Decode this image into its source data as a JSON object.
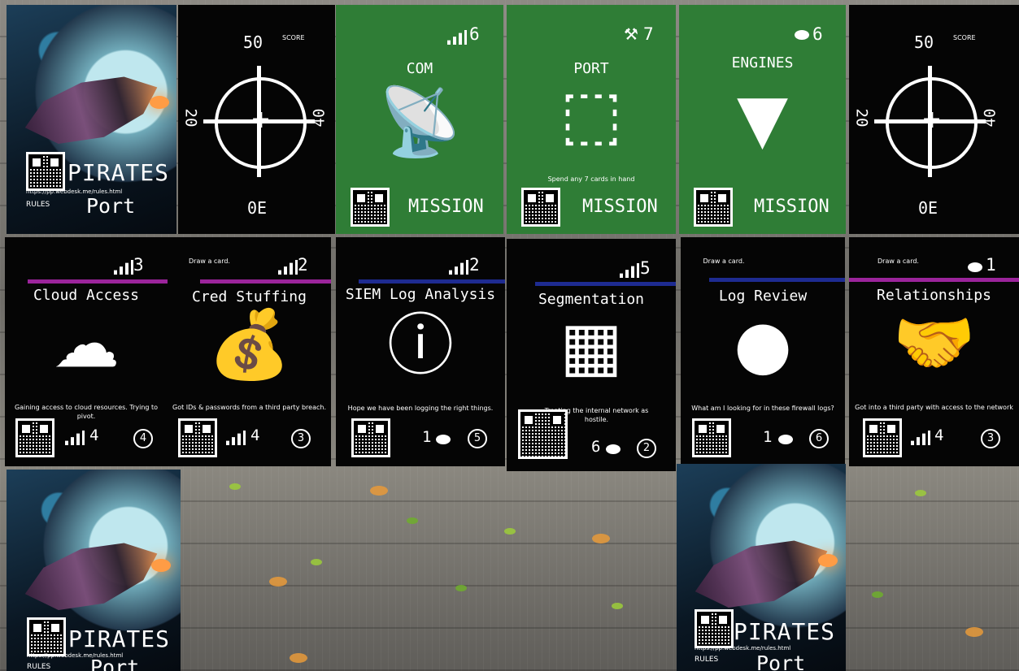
{
  "back_card": {
    "pirates": "PIRATES",
    "url": "https://pp.webdesk.me/rules.html",
    "rules": "RULES",
    "location": "Port"
  },
  "score_card": {
    "top": "50",
    "score_label": "SCORE",
    "left": "20",
    "right": "40",
    "bottom": "0E"
  },
  "ship_cards": [
    {
      "value": "6",
      "title": "COM",
      "label": "MISSION"
    },
    {
      "value": "7",
      "title": "PORT",
      "text": "Spend any 7 cards in hand",
      "label": "MISSION"
    },
    {
      "value": "6",
      "title": "ENGINES",
      "label": "MISSION"
    }
  ],
  "cards": [
    {
      "top_text": "",
      "value": "3",
      "title": "Cloud Access",
      "text": "Gaining access to cloud resources. Trying to pivot.",
      "bottom": "4",
      "circle": "4",
      "bar_color": "#9b249b"
    },
    {
      "top_text": "Draw a card.",
      "value": "2",
      "title": "Cred Stuffing",
      "text": "Got IDs & passwords from a third party breach.",
      "bottom": "4",
      "circle": "3",
      "bar_color": "#9b249b"
    },
    {
      "top_text": "",
      "value": "2",
      "title": "SIEM Log Analysis",
      "text": "Hope we have been logging the right things.",
      "bottom": "1",
      "circle": "5",
      "bar_color": "#1e2b91"
    },
    {
      "top_text": "",
      "value": "5",
      "title": "Segmentation",
      "text": "Treating the internal network as hostile.",
      "bottom": "6",
      "circle": "2",
      "bar_color": "#1e2b91"
    },
    {
      "top_text": "Draw a card.",
      "value": "",
      "title": "Log Review",
      "text": "What am I looking for in these firewall logs?",
      "bottom": "1",
      "circle": "6",
      "bar_color": "#1e2b91"
    },
    {
      "top_text": "Draw a card.",
      "value": "1",
      "title": "Relationships",
      "text": "Got into a third party with access to the network",
      "bottom": "4",
      "circle": "3",
      "bar_color": "#9b249b"
    }
  ]
}
